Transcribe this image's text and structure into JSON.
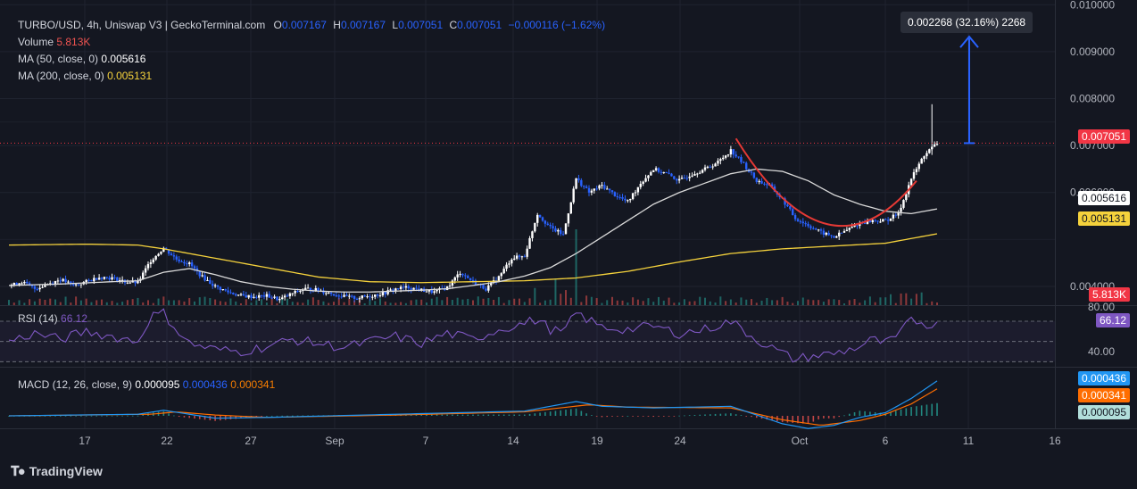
{
  "header": {
    "symbol": "TURBO/USD, 4h, Uniswap V3 | GeckoTerminal.com",
    "o_label": "O",
    "o_value": "0.007167",
    "h_label": "H",
    "h_value": "0.007167",
    "l_label": "L",
    "l_value": "0.007051",
    "c_label": "C",
    "c_value": "0.007051",
    "change": "−0.000116 (−1.62%)"
  },
  "legend": {
    "volume_label": "Volume",
    "volume_value": "5.813K",
    "ma50_label": "MA (50, close, 0)",
    "ma50_value": "0.005616",
    "ma200_label": "MA (200, close, 0)",
    "ma200_value": "0.005131",
    "rsi_label": "RSI (14)",
    "rsi_value": "66.12",
    "macd_label": "MACD (12, 26, close, 9)",
    "macd_hist": "0.000095",
    "macd_line": "0.000436",
    "macd_signal": "0.000341"
  },
  "measure_label": "0.002268 (32.16%) 2268",
  "price_tags": {
    "last": "0.007051",
    "ma50": "0.005616",
    "ma200": "0.005131",
    "volume": "5.813K",
    "rsi": "66.12",
    "macd_line": "0.000436",
    "macd_signal": "0.000341",
    "macd_hist": "0.000095"
  },
  "branding": "TradingView",
  "colors": {
    "background": "#141721",
    "up": "#ffffff",
    "down": "#2962ff",
    "ma50": "#d9d9d9",
    "ma200": "#f5d23c",
    "rsi": "#7e57c2",
    "macd": "#2196f3",
    "signal": "#ff6d00",
    "curve": "#e53935",
    "last_price": "#f23645"
  },
  "chart_data": {
    "type": "candlestick",
    "timeframe": "4h",
    "y_ticks": [
      "0.004000",
      "0.006000",
      "0.007000",
      "0.008000",
      "0.009000",
      "0.010000"
    ],
    "y_range": [
      0.0036,
      0.0101
    ],
    "x_ticks": [
      "17",
      "22",
      "27",
      "Sep",
      "7",
      "14",
      "19",
      "24",
      "Oct",
      "6",
      "11",
      "16"
    ],
    "rsi_ticks": [
      "80.00",
      "40.00"
    ],
    "rsi_range": [
      25,
      85
    ],
    "price_path": [
      [
        0,
        0.004
      ],
      [
        5,
        0.0041
      ],
      [
        10,
        0.00395
      ],
      [
        15,
        0.00405
      ],
      [
        20,
        0.00415
      ],
      [
        25,
        0.00402
      ],
      [
        30,
        0.0041
      ],
      [
        35,
        0.0042
      ],
      [
        40,
        0.00418
      ],
      [
        45,
        0.0041
      ],
      [
        50,
        0.00408
      ],
      [
        55,
        0.00455
      ],
      [
        60,
        0.00482
      ],
      [
        65,
        0.00458
      ],
      [
        70,
        0.00448
      ],
      [
        75,
        0.0042
      ],
      [
        80,
        0.004
      ],
      [
        85,
        0.00388
      ],
      [
        90,
        0.0038
      ],
      [
        95,
        0.00378
      ],
      [
        100,
        0.0038
      ],
      [
        105,
        0.00372
      ],
      [
        110,
        0.00385
      ],
      [
        115,
        0.00395
      ],
      [
        120,
        0.00392
      ],
      [
        125,
        0.00385
      ],
      [
        130,
        0.00378
      ],
      [
        135,
        0.00375
      ],
      [
        140,
        0.0038
      ],
      [
        145,
        0.00385
      ],
      [
        150,
        0.00395
      ],
      [
        155,
        0.00398
      ],
      [
        160,
        0.00392
      ],
      [
        165,
        0.00388
      ],
      [
        170,
        0.00398
      ],
      [
        175,
        0.0043
      ],
      [
        180,
        0.0041
      ],
      [
        185,
        0.00395
      ],
      [
        190,
        0.0042
      ],
      [
        195,
        0.0046
      ],
      [
        200,
        0.00465
      ],
      [
        205,
        0.00555
      ],
      [
        210,
        0.00525
      ],
      [
        215,
        0.0051
      ],
      [
        220,
        0.0063
      ],
      [
        225,
        0.006
      ],
      [
        230,
        0.00615
      ],
      [
        235,
        0.00595
      ],
      [
        240,
        0.0058
      ],
      [
        245,
        0.0062
      ],
      [
        250,
        0.0065
      ],
      [
        255,
        0.0064
      ],
      [
        260,
        0.00625
      ],
      [
        265,
        0.0064
      ],
      [
        270,
        0.0065
      ],
      [
        275,
        0.00665
      ],
      [
        280,
        0.0069
      ],
      [
        285,
        0.0066
      ],
      [
        290,
        0.00625
      ],
      [
        295,
        0.00615
      ],
      [
        300,
        0.00585
      ],
      [
        305,
        0.00545
      ],
      [
        310,
        0.0053
      ],
      [
        315,
        0.00515
      ],
      [
        320,
        0.00505
      ],
      [
        325,
        0.0052
      ],
      [
        330,
        0.00535
      ],
      [
        335,
        0.0054
      ],
      [
        340,
        0.0054
      ],
      [
        345,
        0.00555
      ],
      [
        350,
        0.0063
      ],
      [
        355,
        0.0068
      ],
      [
        360,
        0.00705
      ]
    ],
    "ma50_path": [
      [
        0,
        0.00402
      ],
      [
        20,
        0.00405
      ],
      [
        40,
        0.0041
      ],
      [
        50,
        0.00412
      ],
      [
        60,
        0.0043
      ],
      [
        70,
        0.00438
      ],
      [
        80,
        0.00425
      ],
      [
        90,
        0.0041
      ],
      [
        100,
        0.004
      ],
      [
        110,
        0.00394
      ],
      [
        120,
        0.0039
      ],
      [
        130,
        0.00388
      ],
      [
        140,
        0.00388
      ],
      [
        150,
        0.0039
      ],
      [
        160,
        0.00392
      ],
      [
        170,
        0.00395
      ],
      [
        180,
        0.00402
      ],
      [
        190,
        0.0041
      ],
      [
        200,
        0.00422
      ],
      [
        210,
        0.0044
      ],
      [
        220,
        0.0047
      ],
      [
        230,
        0.00505
      ],
      [
        240,
        0.0054
      ],
      [
        250,
        0.00575
      ],
      [
        260,
        0.006
      ],
      [
        270,
        0.0062
      ],
      [
        280,
        0.0064
      ],
      [
        290,
        0.0065
      ],
      [
        300,
        0.00645
      ],
      [
        310,
        0.00625
      ],
      [
        320,
        0.00595
      ],
      [
        330,
        0.00575
      ],
      [
        340,
        0.0056
      ],
      [
        350,
        0.00555
      ],
      [
        360,
        0.00565
      ]
    ],
    "ma200_path": [
      [
        0,
        0.00488
      ],
      [
        30,
        0.0049
      ],
      [
        50,
        0.00488
      ],
      [
        60,
        0.0048
      ],
      [
        80,
        0.0046
      ],
      [
        100,
        0.0044
      ],
      [
        120,
        0.0042
      ],
      [
        140,
        0.0041
      ],
      [
        160,
        0.00408
      ],
      [
        180,
        0.0041
      ],
      [
        200,
        0.00412
      ],
      [
        220,
        0.00418
      ],
      [
        240,
        0.00432
      ],
      [
        260,
        0.00452
      ],
      [
        280,
        0.0047
      ],
      [
        300,
        0.0048
      ],
      [
        320,
        0.00486
      ],
      [
        340,
        0.00492
      ],
      [
        360,
        0.00512
      ]
    ],
    "rsi_path": [
      [
        0,
        50
      ],
      [
        10,
        58
      ],
      [
        20,
        52
      ],
      [
        30,
        60
      ],
      [
        40,
        55
      ],
      [
        50,
        50
      ],
      [
        55,
        75
      ],
      [
        60,
        78
      ],
      [
        65,
        62
      ],
      [
        70,
        48
      ],
      [
        80,
        42
      ],
      [
        90,
        40
      ],
      [
        100,
        45
      ],
      [
        110,
        52
      ],
      [
        120,
        48
      ],
      [
        130,
        44
      ],
      [
        140,
        50
      ],
      [
        150,
        55
      ],
      [
        160,
        48
      ],
      [
        170,
        58
      ],
      [
        180,
        52
      ],
      [
        190,
        62
      ],
      [
        200,
        68
      ],
      [
        205,
        72
      ],
      [
        210,
        62
      ],
      [
        215,
        58
      ],
      [
        220,
        78
      ],
      [
        230,
        64
      ],
      [
        240,
        62
      ],
      [
        250,
        65
      ],
      [
        260,
        58
      ],
      [
        270,
        62
      ],
      [
        280,
        70
      ],
      [
        290,
        52
      ],
      [
        300,
        38
      ],
      [
        305,
        32
      ],
      [
        310,
        35
      ],
      [
        320,
        38
      ],
      [
        330,
        45
      ],
      [
        335,
        52
      ],
      [
        340,
        48
      ],
      [
        345,
        55
      ],
      [
        350,
        72
      ],
      [
        355,
        68
      ],
      [
        360,
        66
      ]
    ],
    "macd_path": [
      [
        0,
        0
      ],
      [
        50,
        2e-05
      ],
      [
        60,
        7e-05
      ],
      [
        70,
        2e-05
      ],
      [
        80,
        -3e-05
      ],
      [
        100,
        -2e-05
      ],
      [
        150,
        2e-05
      ],
      [
        200,
        6e-05
      ],
      [
        220,
        0.00018
      ],
      [
        230,
        0.00012
      ],
      [
        250,
        0.0001
      ],
      [
        280,
        0.00012
      ],
      [
        300,
        -0.0001
      ],
      [
        310,
        -0.00016
      ],
      [
        320,
        -0.00012
      ],
      [
        330,
        -2e-05
      ],
      [
        340,
        4e-05
      ],
      [
        350,
        0.00022
      ],
      [
        360,
        0.00044
      ]
    ],
    "signal_path": [
      [
        0,
        0
      ],
      [
        55,
        2e-05
      ],
      [
        65,
        5e-05
      ],
      [
        80,
        1e-05
      ],
      [
        100,
        -2e-05
      ],
      [
        150,
        1e-05
      ],
      [
        200,
        5e-05
      ],
      [
        225,
        0.00014
      ],
      [
        240,
        0.00011
      ],
      [
        280,
        0.0001
      ],
      [
        300,
        -5e-05
      ],
      [
        315,
        -0.00012
      ],
      [
        330,
        -6e-05
      ],
      [
        340,
        2e-05
      ],
      [
        350,
        0.00015
      ],
      [
        360,
        0.00034
      ]
    ],
    "last_price": 0.007051,
    "measure_from": 0.007051,
    "measure_to": 0.009319
  }
}
